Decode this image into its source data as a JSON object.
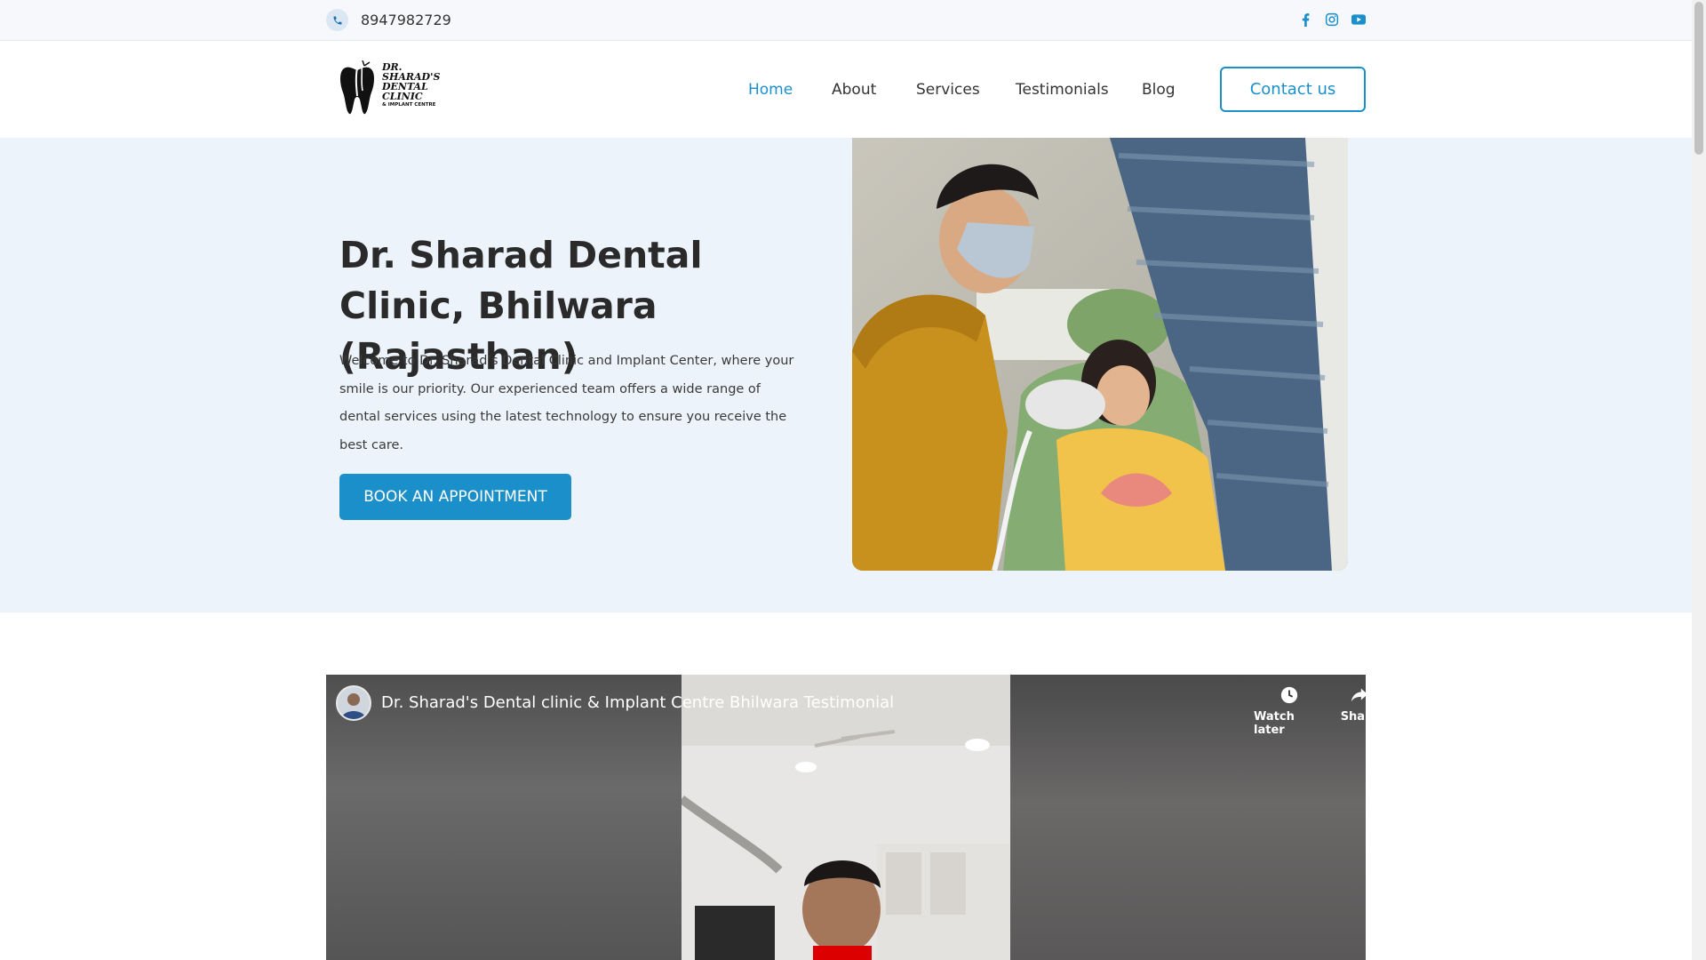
{
  "topbar": {
    "phone": "8947982729",
    "phone_icon": "phone-icon",
    "social": [
      "facebook-icon",
      "instagram-icon",
      "youtube-icon"
    ]
  },
  "nav": {
    "logo_lines": [
      "DR.",
      "SHARAD'S",
      "DENTAL",
      "CLINIC",
      "& IMPLANT CENTRE"
    ],
    "items": [
      {
        "label": "Home",
        "active": true
      },
      {
        "label": "About"
      },
      {
        "label": "Services"
      },
      {
        "label": "Testimonials"
      },
      {
        "label": "Blog"
      }
    ],
    "contact_label": "Contact us"
  },
  "hero": {
    "title": "Dr. Sharad Dental Clinic, Bhilwara (Rajasthan)",
    "text": "Welcome to Dr. Sharad’s Dental Clinic and Implant Center, where your smile is our priority. Our experienced team offers a wide range of dental services using the latest technology to ensure you receive the best care.",
    "button": "BOOK AN APPOINTMENT"
  },
  "video": {
    "title": "Dr. Sharad's Dental clinic & Implant Centre Bhilwara Testimonial",
    "watch_later": "Watch later",
    "share": "Share"
  },
  "colors": {
    "accent": "#1a8fca",
    "hero_bg": "#edf3fa",
    "topbar_bg": "#f6f8fb"
  }
}
